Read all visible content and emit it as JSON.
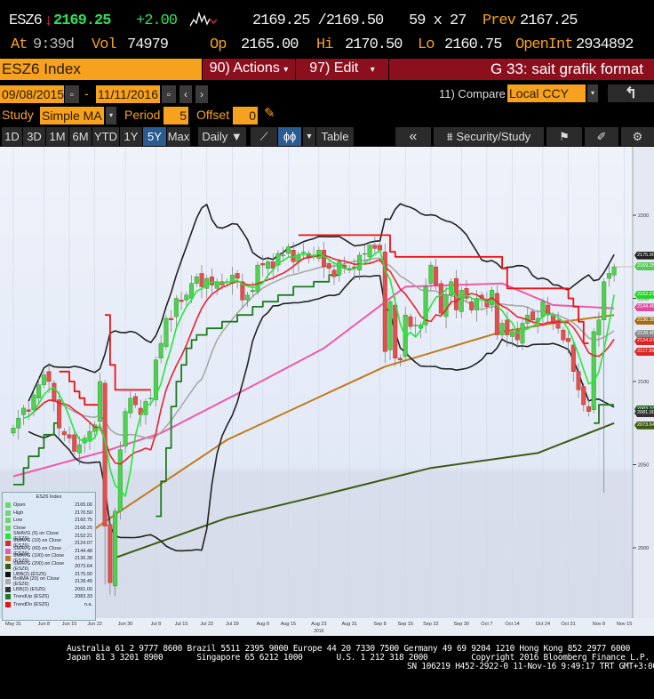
{
  "quote": {
    "ticker": "ESZ6",
    "last": "2169.25",
    "change": "+2.00",
    "bid_ask": "2169.25 /2169.50",
    "size": "59 x 27",
    "prev_label": "Prev",
    "prev": "2167.25",
    "at_label": "At",
    "at": "9:39d",
    "vol_label": "Vol",
    "vol": "74979",
    "op_label": "Op",
    "op": "2165.00",
    "hi_label": "Hi",
    "hi": "2170.50",
    "lo_label": "Lo",
    "lo": "2160.75",
    "oi_label": "OpenInt",
    "oi": "2934892"
  },
  "toolbar": {
    "security": "ESZ6 Index",
    "actions": "90) Actions",
    "edit": "97) Edit",
    "title": "G 33: sait grafik format"
  },
  "range": {
    "start": "09/08/2015",
    "dash": "-",
    "end": "11/11/2016",
    "compare_label": "11) Compare",
    "compare_value": "Local CCY"
  },
  "study": {
    "label": "Study",
    "value": "Simple MA",
    "period_label": "Period",
    "period": "5",
    "offset_label": "Offset",
    "offset": "0"
  },
  "periods": [
    "1D",
    "3D",
    "1M",
    "6M",
    "YTD",
    "1Y",
    "5Y",
    "Max"
  ],
  "selected_period": "5Y",
  "frequency": "Daily ▼",
  "table": "Table",
  "security_study": "Security/Study",
  "colors": {
    "up": "#4fd04f",
    "down": "#e0504c",
    "sma5": "#22e83a",
    "sma10": "#e8222e",
    "sma60": "#ee5aa8",
    "sma100": "#c07a1c",
    "sma200": "#3d5a12",
    "bollinger": "#222222",
    "sma20": "#a8a8a8",
    "trend_up": "#1f7a1f",
    "trend_dn": "#ee1111"
  },
  "chart_data": {
    "type": "candlestick",
    "y_ticks": [
      "2200",
      "2150",
      "2100",
      "2050",
      "2000"
    ],
    "x_ticks": [
      "May 31",
      "Jun 8",
      "Jun 15",
      "Jun 22",
      "Jun 30",
      "Jul 8",
      "Jul 15",
      "Jul 22",
      "Jul 29",
      "Aug 8",
      "Aug 15",
      "Aug 23",
      "Aug 31",
      "Sep 8",
      "Sep 15",
      "Sep 22",
      "Sep 30",
      "Oct 7",
      "Oct 14",
      "Oct 24",
      "Oct 31",
      "Nov 8",
      "Nov 15"
    ],
    "x_tick_dates": [
      "2016-05-31",
      "2016-06-08",
      "2016-06-15",
      "2016-06-22",
      "2016-06-30",
      "2016-07-08",
      "2016-07-15",
      "2016-07-22",
      "2016-07-29",
      "2016-08-08",
      "2016-08-15",
      "2016-08-23",
      "2016-08-31",
      "2016-09-08",
      "2016-09-15",
      "2016-09-22",
      "2016-09-30",
      "2016-10-07",
      "2016-10-14",
      "2016-10-24",
      "2016-10-31",
      "2016-11-08",
      "2016-11-15"
    ],
    "year_label": "2016",
    "closes": {
      "2016-05-31": 2072,
      "2016-06-01": 2078,
      "2016-06-02": 2084,
      "2016-06-03": 2082,
      "2016-06-06": 2092,
      "2016-06-07": 2098,
      "2016-06-08": 2104,
      "2016-06-09": 2100,
      "2016-06-10": 2088,
      "2016-06-13": 2072,
      "2016-06-14": 2068,
      "2016-06-15": 2066,
      "2016-06-16": 2058,
      "2016-06-17": 2062,
      "2016-06-20": 2066,
      "2016-06-21": 2070,
      "2016-06-22": 2074,
      "2016-06-23": 2100,
      "2016-06-24": 2013,
      "2016-06-27": 1979,
      "2016-06-28": 2022,
      "2016-06-29": 2059,
      "2016-06-30": 2082,
      "2016-07-01": 2090,
      "2016-07-04": 2086,
      "2016-07-05": 2080,
      "2016-07-06": 2088,
      "2016-07-07": 2090,
      "2016-07-08": 2113,
      "2016-07-11": 2123,
      "2016-07-12": 2138,
      "2016-07-13": 2137,
      "2016-07-14": 2150,
      "2016-07-15": 2148,
      "2016-07-18": 2152,
      "2016-07-19": 2159,
      "2016-07-20": 2163,
      "2016-07-21": 2157,
      "2016-07-22": 2162,
      "2016-07-25": 2158,
      "2016-07-26": 2160,
      "2016-07-27": 2158,
      "2016-07-28": 2160,
      "2016-07-29": 2164,
      "2016-08-01": 2162,
      "2016-08-02": 2149,
      "2016-08-03": 2152,
      "2016-08-04": 2155,
      "2016-08-05": 2170,
      "2016-08-08": 2170,
      "2016-08-09": 2172,
      "2016-08-10": 2168,
      "2016-08-11": 2177,
      "2016-08-12": 2176,
      "2016-08-15": 2181,
      "2016-08-16": 2172,
      "2016-08-17": 2176,
      "2016-08-18": 2178,
      "2016-08-19": 2175,
      "2016-08-22": 2176,
      "2016-08-23": 2179,
      "2016-08-24": 2169,
      "2016-08-25": 2168,
      "2016-08-26": 2163,
      "2016-08-29": 2172,
      "2016-08-30": 2168,
      "2016-08-31": 2167,
      "2016-09-01": 2168,
      "2016-09-02": 2176,
      "2016-09-05": 2177,
      "2016-09-06": 2182,
      "2016-09-07": 2180,
      "2016-09-08": 2179,
      "2016-09-09": 2118,
      "2016-09-12": 2148,
      "2016-09-13": 2114,
      "2016-09-14": 2113,
      "2016-09-15": 2140,
      "2016-09-16": 2133,
      "2016-09-19": 2134,
      "2016-09-20": 2134,
      "2016-09-21": 2157,
      "2016-09-22": 2170,
      "2016-09-23": 2158,
      "2016-09-26": 2141,
      "2016-09-27": 2152,
      "2016-09-28": 2160,
      "2016-09-29": 2143,
      "2016-09-30": 2155,
      "2016-10-03": 2150,
      "2016-10-04": 2143,
      "2016-10-05": 2150,
      "2016-10-06": 2150,
      "2016-10-07": 2145,
      "2016-10-10": 2155,
      "2016-10-11": 2128,
      "2016-10-12": 2135,
      "2016-10-13": 2128,
      "2016-10-14": 2130,
      "2016-10-17": 2125,
      "2016-10-18": 2135,
      "2016-10-19": 2140,
      "2016-10-20": 2137,
      "2016-10-21": 2138,
      "2016-10-24": 2148,
      "2016-10-25": 2140,
      "2016-10-26": 2135,
      "2016-10-27": 2132,
      "2016-10-28": 2125,
      "2016-10-31": 2124,
      "2016-11-01": 2106,
      "2016-11-02": 2095,
      "2016-11-03": 2086,
      "2016-11-04": 2082,
      "2016-11-07": 2130,
      "2016-11-08": 2137,
      "2016-11-09": 2160,
      "2016-11-10": 2165,
      "2016-11-11": 2169
    },
    "lows": {
      "2016-06-24": 1978,
      "2016-11-09": 2033
    },
    "sma60": [
      [
        "2016-05-31",
        2043
      ],
      [
        "2016-06-24",
        2058
      ],
      [
        "2016-07-11",
        2069
      ],
      [
        "2016-08-05",
        2099
      ],
      [
        "2016-08-24",
        2120
      ],
      [
        "2016-09-15",
        2157
      ],
      [
        "2016-10-12",
        2159
      ],
      [
        "2016-10-26",
        2146
      ],
      [
        "2016-11-11",
        2144
      ]
    ],
    "sma100": [
      [
        "2016-05-31",
        1977
      ],
      [
        "2016-06-28",
        2020
      ],
      [
        "2016-07-28",
        2065
      ],
      [
        "2016-08-24",
        2092
      ],
      [
        "2016-09-09",
        2109
      ],
      [
        "2016-10-12",
        2130
      ],
      [
        "2016-10-28",
        2136
      ],
      [
        "2016-11-11",
        2140
      ]
    ],
    "sma200": [
      [
        "2016-06-28",
        1994
      ],
      [
        "2016-07-28",
        2018
      ],
      [
        "2016-08-24",
        2032
      ],
      [
        "2016-09-22",
        2048
      ],
      [
        "2016-10-21",
        2057
      ],
      [
        "2016-11-11",
        2075
      ]
    ],
    "trend_dn": [
      [
        [
          "2016-06-13",
          2106
        ],
        [
          "2016-06-15",
          2100
        ],
        [
          "2016-06-16",
          2094
        ],
        [
          "2016-06-17",
          2090
        ],
        [
          "2016-06-20",
          2086
        ],
        [
          "2016-06-23",
          2086
        ]
      ],
      [
        [
          "2016-06-24",
          2140
        ],
        [
          "2016-06-27",
          2110
        ],
        [
          "2016-06-28",
          2095
        ],
        [
          "2016-07-07",
          2095
        ]
      ],
      [
        [
          "2016-08-17",
          2188
        ],
        [
          "2016-09-12",
          2178
        ],
        [
          "2016-09-13",
          2175
        ],
        [
          "2016-10-12",
          2168
        ],
        [
          "2016-10-13",
          2156
        ],
        [
          "2016-10-31",
          2150
        ],
        [
          "2016-11-01",
          2145
        ],
        [
          "2016-11-02",
          2136
        ],
        [
          "2016-11-03",
          2123
        ],
        [
          "2016-11-04",
          2123
        ]
      ]
    ],
    "trend_up": [
      [
        [
          "2016-05-31",
          2038
        ],
        [
          "2016-06-02",
          2048
        ],
        [
          "2016-06-03",
          2055
        ],
        [
          "2016-06-07",
          2060
        ],
        [
          "2016-06-08",
          2068
        ],
        [
          "2016-06-10",
          2075
        ],
        [
          "2016-06-13",
          2075
        ]
      ],
      [
        [
          "2016-07-08",
          2019
        ],
        [
          "2016-07-11",
          2040
        ],
        [
          "2016-07-12",
          2060
        ],
        [
          "2016-07-13",
          2085
        ],
        [
          "2016-07-14",
          2100
        ],
        [
          "2016-07-15",
          2110
        ],
        [
          "2016-07-18",
          2120
        ],
        [
          "2016-07-19",
          2125
        ],
        [
          "2016-07-20",
          2128
        ],
        [
          "2016-07-22",
          2132
        ],
        [
          "2016-07-27",
          2136
        ],
        [
          "2016-08-01",
          2140
        ],
        [
          "2016-08-04",
          2145
        ],
        [
          "2016-08-08",
          2148
        ],
        [
          "2016-08-11",
          2152
        ],
        [
          "2016-08-16",
          2157
        ],
        [
          "2016-08-22",
          2160
        ],
        [
          "2016-08-25",
          2164
        ],
        [
          "2016-08-29",
          2164
        ]
      ],
      [
        [
          "2016-11-07",
          2075
        ],
        [
          "2016-11-08",
          2086
        ],
        [
          "2016-11-11",
          2086
        ]
      ]
    ],
    "right_labels": [
      {
        "v": "2175.90",
        "c": "#222222"
      },
      {
        "v": "2169.25",
        "c": "#58c858"
      },
      {
        "v": "2152.21",
        "c": "#22d822"
      },
      {
        "v": "2144.48",
        "c": "#e04aa0"
      },
      {
        "v": "2136.38",
        "c": "#a86a14"
      },
      {
        "v": "2128.45",
        "c": "#888888"
      },
      {
        "v": "2124.07",
        "c": "#dd2222"
      },
      {
        "v": "2117.89",
        "c": "#dd2222"
      },
      {
        "v": "2083.33",
        "c": "#1f5a1f"
      },
      {
        "v": "2081.00",
        "c": "#333333"
      },
      {
        "v": "2073.64",
        "c": "#3d5a12"
      }
    ]
  },
  "legend": {
    "title": "ESZ6 Index",
    "items": [
      {
        "name": "Open",
        "value": "2165.00",
        "color": "#6cd86c"
      },
      {
        "name": "High",
        "value": "2170.50",
        "color": "#6cd86c"
      },
      {
        "name": "Low",
        "value": "2160.75",
        "color": "#6cd86c"
      },
      {
        "name": "Close",
        "value": "2168.25",
        "color": "#6cd86c"
      },
      {
        "name": "SMAVG (5) on Close (ESZ6)",
        "value": "2152.21",
        "color": "#22e83a"
      },
      {
        "name": "SMAVG (10) on Close (ESZ6)",
        "value": "2124.07",
        "color": "#e8222e"
      },
      {
        "name": "SMAVG (60) on Close (ESZ6)",
        "value": "2144.48",
        "color": "#ee5aa8"
      },
      {
        "name": "SMAVG (100) on Close (ESZ6)",
        "value": "2136.38",
        "color": "#c07a1c"
      },
      {
        "name": "SMAVG (200) on Close (ESZ6)",
        "value": "2073.64",
        "color": "#3d5a12"
      },
      {
        "name": "UBB(2) (ESZ6)",
        "value": "2175.90",
        "color": "#111"
      },
      {
        "name": "BollMA (20) on Close (ESZ6)",
        "value": "2128.45",
        "color": "#aaa"
      },
      {
        "name": "LBB(2) (ESZ6)",
        "value": "2081.00",
        "color": "#333"
      },
      {
        "name": "TrendUp (ESZ6)",
        "value": "2083.33",
        "color": "#1f7a1f"
      },
      {
        "name": "TrendDn (ESZ6)",
        "value": "n.a.",
        "color": "#ee1111"
      }
    ]
  },
  "footer": {
    "line1": "Australia 61 2 9777 8600 Brazil 5511 2395 9000 Europe 44 20 7330 7500 Germany 49 69 9204 1210 Hong Kong 852 2977 6000",
    "line2": "Japan 81 3 3201 8900       Singapore 65 6212 1000       U.S. 1 212 318 2000         Copyright 2016 Bloomberg Finance L.P.",
    "line3": "SN 106219 H452-2922-0 11-Nov-16  9:49:17 TRT  GMT+3:00"
  }
}
